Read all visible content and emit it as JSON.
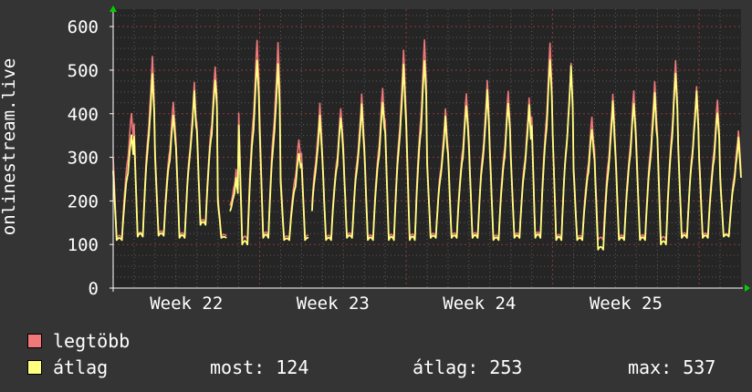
{
  "colors": {
    "background": "#343434",
    "plot_bg": "#252525",
    "grid": "#5a5a5a",
    "grid_major": "#8a3b3b",
    "axis": "#ffffff",
    "arrow": "#00d000",
    "max_line": "#f07878",
    "avg_line": "#ffff80"
  },
  "legend": {
    "max_label": "legtöbb",
    "avg_label": "átlag"
  },
  "stats": {
    "current": "most: 124",
    "average": "átlag: 253",
    "maximum": "max: 537"
  },
  "chart_data": {
    "type": "line",
    "ylabel": "onlinestream.live",
    "ylim": [
      0,
      640
    ],
    "yticks": [
      0,
      100,
      200,
      300,
      400,
      500,
      600
    ],
    "xlim_days": [
      0,
      30
    ],
    "xticks": [
      {
        "label": "Week 22",
        "day": 3.5
      },
      {
        "label": "Week 23",
        "day": 10.5
      },
      {
        "label": "Week 24",
        "day": 17.5
      },
      {
        "label": "Week 25",
        "day": 24.5
      }
    ],
    "grid": true,
    "legend_position": "bottom-left",
    "series": [
      {
        "name": "legtöbb",
        "color": "#f07878",
        "daily_peaks": [
          410,
          530,
          435,
          470,
          515,
          270,
          575,
          560,
          345,
          420,
          415,
          440,
          460,
          540,
          570,
          405,
          445,
          470,
          450,
          430,
          560,
          510,
          390,
          440,
          450,
          470,
          520,
          460,
          430,
          360
        ],
        "daily_mins": [
          115,
          120,
          125,
          120,
          150,
          120,
          110,
          120,
          115,
          115,
          115,
          120,
          115,
          115,
          115,
          120,
          120,
          120,
          115,
          120,
          120,
          115,
          115,
          110,
          115,
          115,
          110,
          120,
          120,
          120
        ],
        "gap_days": [
          5.5,
          9.4
        ]
      },
      {
        "name": "átlag",
        "color": "#ffff80",
        "daily_peaks": [
          360,
          490,
          405,
          450,
          485,
          250,
          530,
          510,
          315,
          390,
          395,
          415,
          430,
          505,
          525,
          385,
          420,
          445,
          425,
          410,
          525,
          500,
          365,
          420,
          425,
          440,
          495,
          445,
          405,
          340
        ],
        "daily_mins": [
          110,
          118,
          120,
          115,
          145,
          115,
          100,
          115,
          110,
          110,
          110,
          115,
          110,
          110,
          110,
          115,
          115,
          115,
          110,
          115,
          115,
          110,
          110,
          88,
          110,
          110,
          100,
          115,
          115,
          118
        ],
        "gap_days": [
          5.5,
          9.4
        ]
      }
    ]
  }
}
